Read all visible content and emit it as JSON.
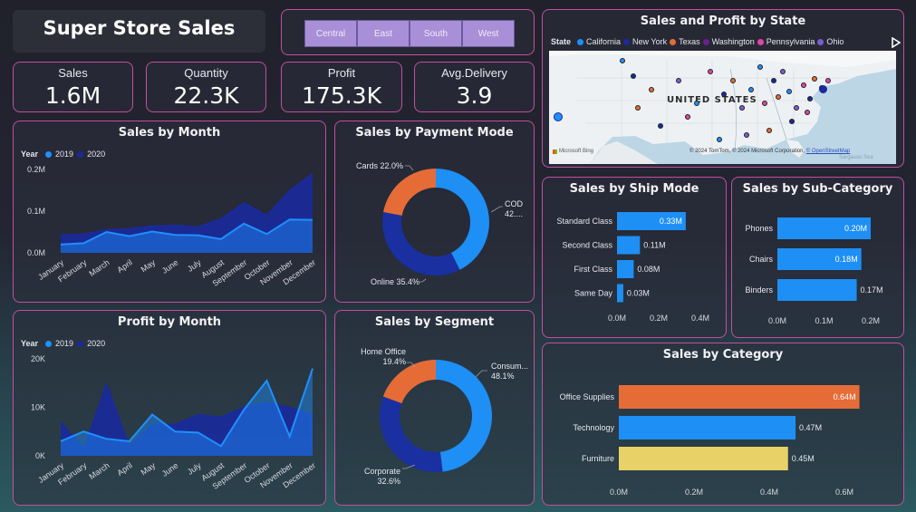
{
  "app": {
    "title": "Super Store Sales"
  },
  "slicer": {
    "regions": [
      "Central",
      "East",
      "South",
      "West"
    ]
  },
  "kpis": [
    {
      "label": "Sales",
      "value": "1.6M"
    },
    {
      "label": "Quantity",
      "value": "22.3K"
    },
    {
      "label": "Profit",
      "value": "175.3K"
    },
    {
      "label": "Avg.Delivery",
      "value": "3.9"
    }
  ],
  "colors": {
    "c2019": "#1e90ff",
    "c2020": "#1a2a9c",
    "orange": "#e66c37",
    "navy": "#1a2fa0",
    "yellow": "#e8d166",
    "blue": "#1e8ff5",
    "card_border": "#c14fa0"
  },
  "map": {
    "title": "Sales and Profit by State",
    "legend_title": "State",
    "legend_items": [
      {
        "name": "California",
        "color": "#1e90ff"
      },
      {
        "name": "New York",
        "color": "#1a2a9c"
      },
      {
        "name": "Texas",
        "color": "#e66c37"
      },
      {
        "name": "Washington",
        "color": "#6b1f8f"
      },
      {
        "name": "Pennsylvania",
        "color": "#e044a7"
      },
      {
        "name": "Ohio",
        "color": "#7b5cd6"
      }
    ],
    "country_label": "UNITED STATES",
    "attribution_left": "Microsoft Bing",
    "attribution_right": "© 2024 TomTom, © 2024 Microsoft Corporation,",
    "attribution_link": "© OpenStreetMap",
    "sea_label": "Sargasso Sea"
  },
  "chart_data": [
    {
      "id": "sales_by_month",
      "type": "area",
      "title": "Sales by Month",
      "legend_title": "Year",
      "categories": [
        "January",
        "February",
        "March",
        "April",
        "May",
        "June",
        "July",
        "August",
        "September",
        "October",
        "November",
        "December"
      ],
      "series": [
        {
          "name": "2019",
          "values": [
            0.02,
            0.023,
            0.05,
            0.04,
            0.051,
            0.043,
            0.042,
            0.033,
            0.07,
            0.045,
            0.08,
            0.079
          ]
        },
        {
          "name": "2020",
          "values": [
            0.043,
            0.045,
            0.055,
            0.058,
            0.064,
            0.066,
            0.062,
            0.082,
            0.12,
            0.09,
            0.15,
            0.19
          ]
        }
      ],
      "yticks": [
        "0.0M",
        "0.1M",
        "0.2M"
      ],
      "ylim": [
        0,
        0.2
      ]
    },
    {
      "id": "profit_by_month",
      "type": "area",
      "title": "Profit by Month",
      "legend_title": "Year",
      "categories": [
        "January",
        "February",
        "March",
        "April",
        "May",
        "June",
        "July",
        "August",
        "September",
        "October",
        "November",
        "December"
      ],
      "series": [
        {
          "name": "2019",
          "values": [
            3000,
            5000,
            3500,
            3000,
            8500,
            5000,
            4800,
            2000,
            9500,
            15500,
            4000,
            18000
          ]
        },
        {
          "name": "2020",
          "values": [
            7000,
            1500,
            14800,
            2000,
            6500,
            6500,
            8500,
            8000,
            10000,
            11000,
            10000,
            8500
          ]
        }
      ],
      "yticks": [
        "0K",
        "10K",
        "20K"
      ],
      "ylim": [
        0,
        20000
      ]
    },
    {
      "id": "sales_by_payment_mode",
      "type": "pie",
      "title": "Sales by Payment Mode",
      "labels": [
        "COD",
        "Online",
        "Cards"
      ],
      "values": [
        42.6,
        35.4,
        22.0
      ],
      "display_labels": [
        "COD\n42....",
        "Online 35.4%",
        "Cards 22.0%"
      ]
    },
    {
      "id": "sales_by_segment",
      "type": "pie",
      "title": "Sales by Segment",
      "labels": [
        "Consumer",
        "Corporate",
        "Home Office"
      ],
      "values": [
        48.1,
        32.6,
        19.4
      ],
      "display_labels": [
        "Consum...\n48.1%",
        "Corporate\n32.6%",
        "Home Office\n19.4%"
      ]
    },
    {
      "id": "sales_by_ship_mode",
      "type": "bar",
      "title": "Sales by Ship Mode",
      "categories": [
        "Standard Class",
        "Second Class",
        "First Class",
        "Same Day"
      ],
      "values": [
        0.33,
        0.11,
        0.08,
        0.03
      ],
      "value_labels": [
        "0.33M",
        "0.11M",
        "0.08M",
        "0.03M"
      ],
      "xticks": [
        "0.0M",
        "0.2M",
        "0.4M"
      ],
      "xlim": [
        0,
        0.4
      ]
    },
    {
      "id": "sales_by_sub_category",
      "type": "bar",
      "title": "Sales by Sub-Category",
      "categories": [
        "Phones",
        "Chairs",
        "Binders"
      ],
      "values": [
        0.2,
        0.18,
        0.17
      ],
      "value_labels": [
        "0.20M",
        "0.18M",
        "0.17M"
      ],
      "xticks": [
        "0.0M",
        "0.1M",
        "0.2M"
      ],
      "xlim": [
        0,
        0.2
      ]
    },
    {
      "id": "sales_by_category",
      "type": "bar",
      "title": "Sales by Category",
      "categories": [
        "Office Supplies",
        "Technology",
        "Furniture"
      ],
      "values": [
        0.64,
        0.47,
        0.45
      ],
      "value_labels": [
        "0.64M",
        "0.47M",
        "0.45M"
      ],
      "xticks": [
        "0.0M",
        "0.2M",
        "0.4M",
        "0.6M"
      ],
      "xlim": [
        0,
        0.6
      ]
    }
  ]
}
